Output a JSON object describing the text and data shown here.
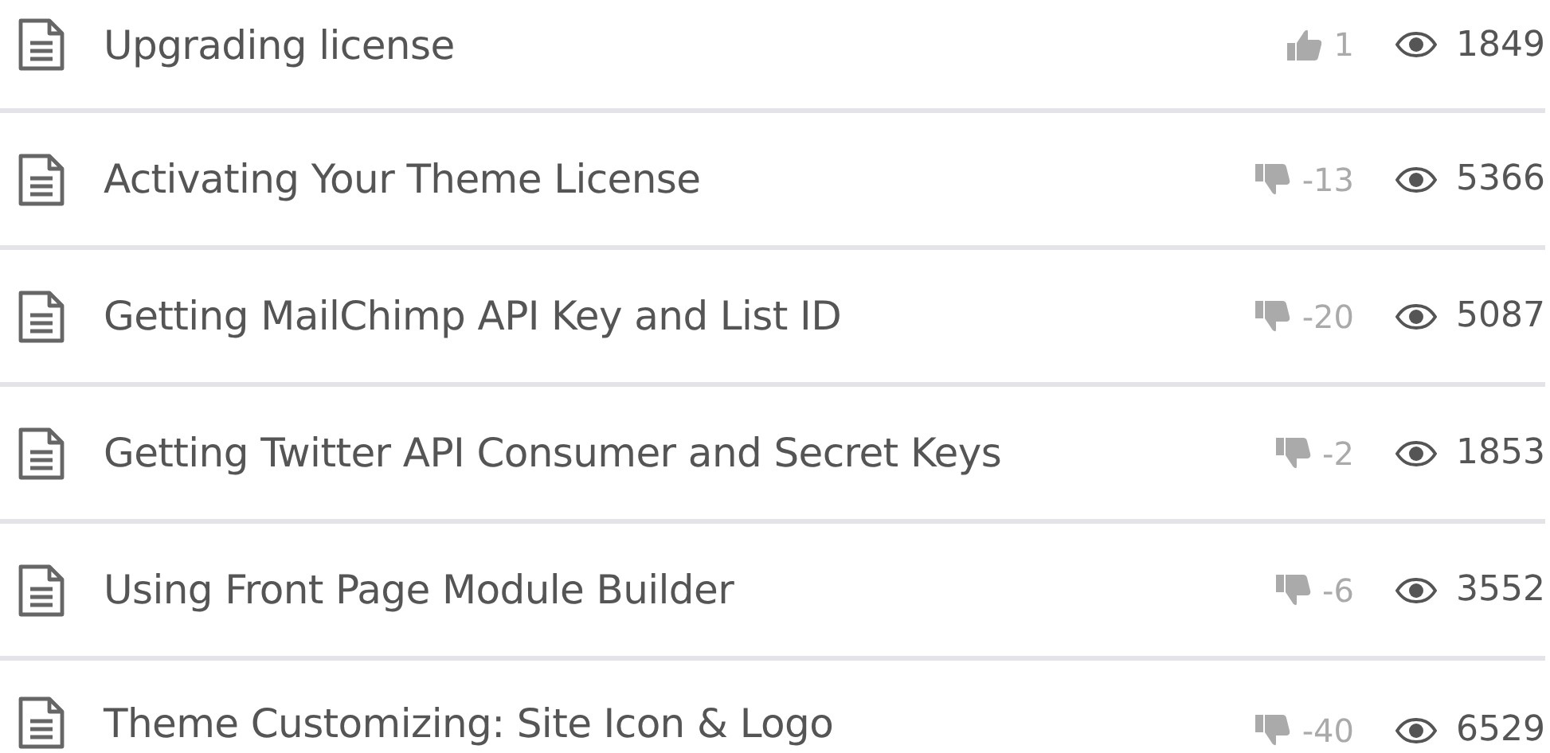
{
  "articles": [
    {
      "title": "Upgrading license",
      "kind": "up",
      "votes": "1",
      "views": "1849"
    },
    {
      "title": "Activating Your Theme License",
      "kind": "down",
      "votes": "-13",
      "views": "5366"
    },
    {
      "title": "Getting MailChimp API Key and List ID",
      "kind": "down",
      "votes": "-20",
      "views": "5087"
    },
    {
      "title": "Getting Twitter API Consumer and Secret Keys",
      "kind": "down",
      "votes": "-2",
      "views": "1853"
    },
    {
      "title": "Using Front Page Module Builder",
      "kind": "down",
      "votes": "-6",
      "views": "3552"
    },
    {
      "title": "Theme Customizing: Site Icon & Logo",
      "kind": "down",
      "votes": "-40",
      "views": "6529"
    }
  ]
}
